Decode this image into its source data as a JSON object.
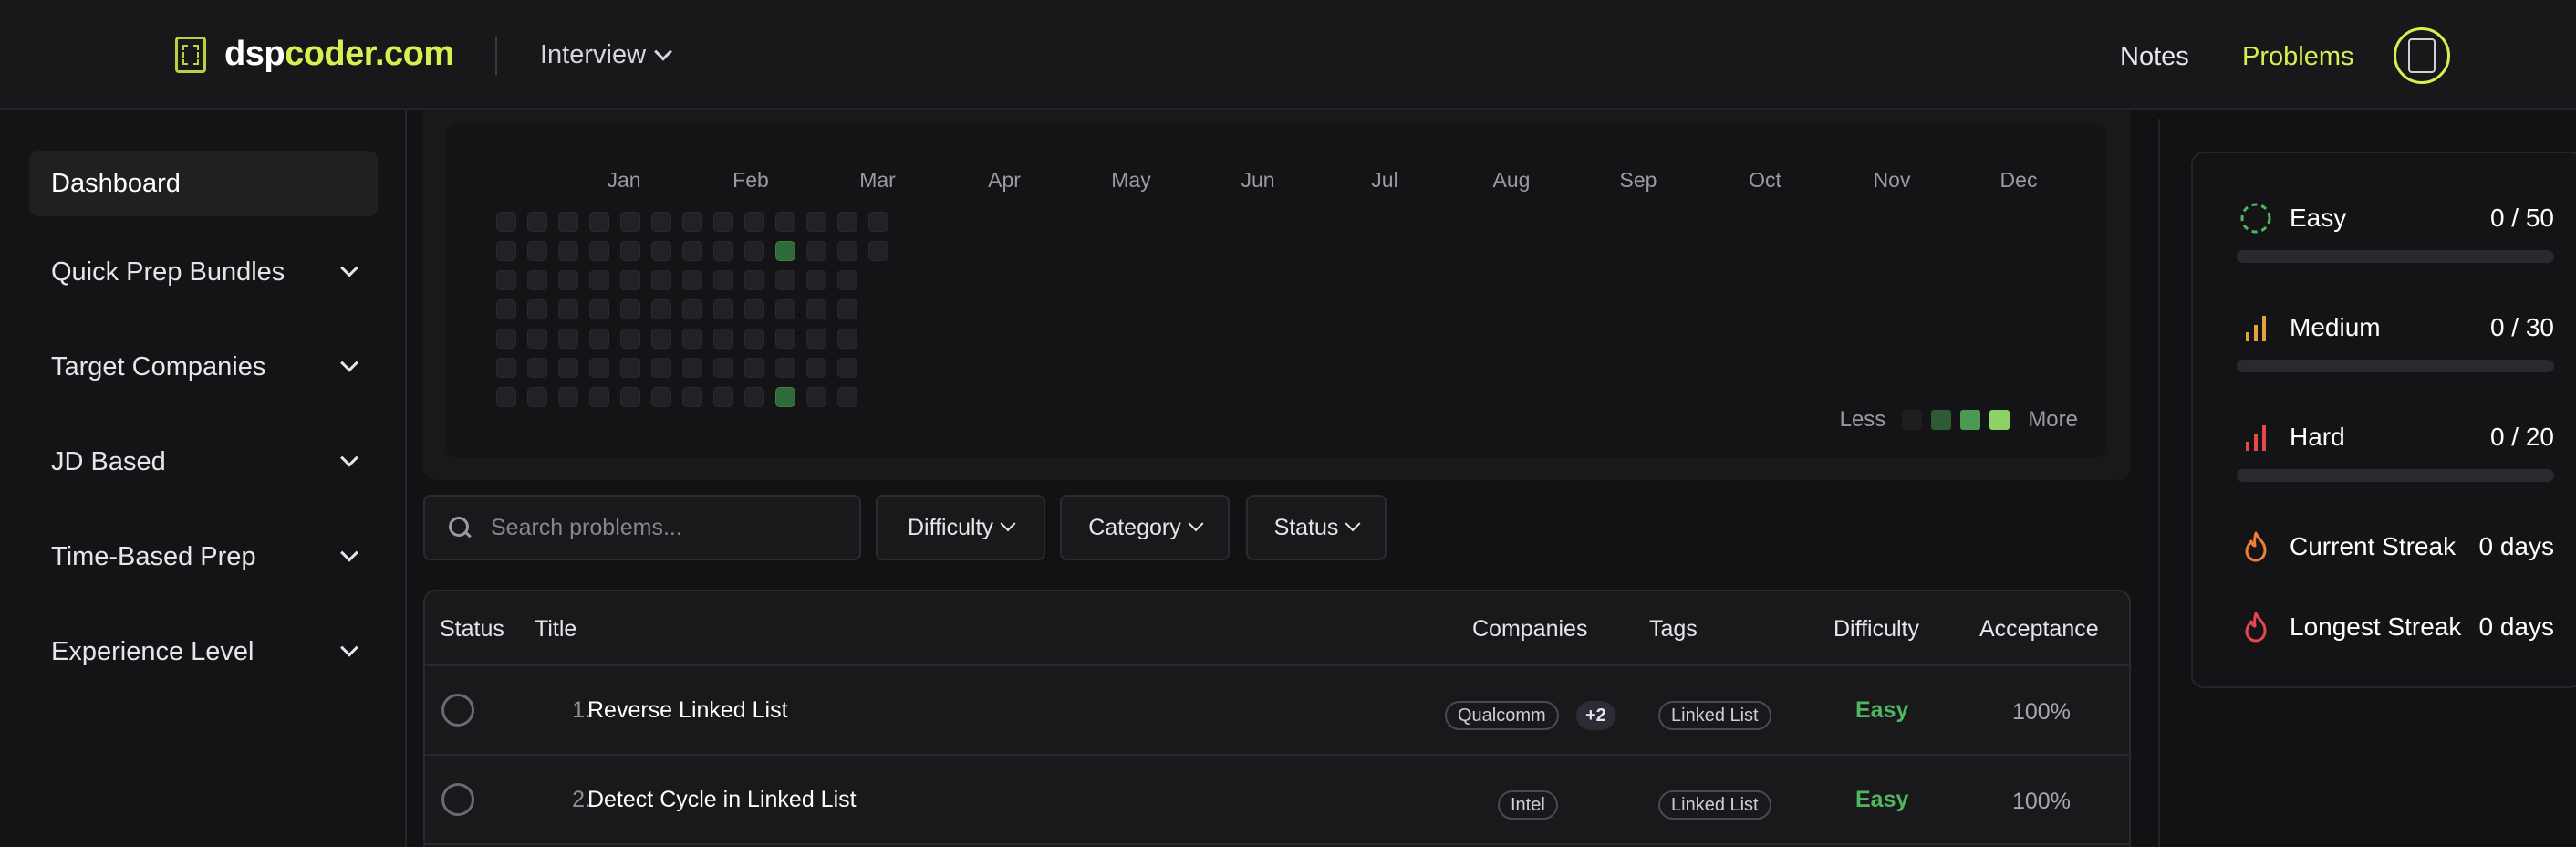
{
  "header": {
    "logo_part1": "dsp",
    "logo_part2": "coder.com",
    "mode": "Interview",
    "nav": {
      "notes": "Notes",
      "problems": "Problems"
    },
    "accent": "#d7ef52"
  },
  "sidebar": {
    "items": [
      {
        "label": "Dashboard",
        "active": true,
        "expandable": false
      },
      {
        "label": "Quick Prep Bundles",
        "active": false,
        "expandable": true
      },
      {
        "label": "Target Companies",
        "active": false,
        "expandable": true
      },
      {
        "label": "JD Based",
        "active": false,
        "expandable": true
      },
      {
        "label": "Time-Based Prep",
        "active": false,
        "expandable": true
      },
      {
        "label": "Experience Level",
        "active": false,
        "expandable": true
      }
    ]
  },
  "heatmap": {
    "months": [
      "Jan",
      "Feb",
      "Mar",
      "Apr",
      "May",
      "Jun",
      "Jul",
      "Aug",
      "Sep",
      "Oct",
      "Nov",
      "Dec"
    ],
    "active_days": [
      {
        "week": 9,
        "day": 1,
        "level": 2
      },
      {
        "week": 9,
        "day": 6,
        "level": 2
      }
    ],
    "legend": {
      "less": "Less",
      "more": "More",
      "colors": [
        "#1e1e21",
        "#2f5a36",
        "#4a9a52",
        "#8fd169"
      ]
    }
  },
  "filters": {
    "search_placeholder": "Search problems...",
    "difficulty": "Difficulty",
    "category": "Category",
    "status": "Status"
  },
  "table": {
    "headers": {
      "status": "Status",
      "title": "Title",
      "companies": "Companies",
      "tags": "Tags",
      "difficulty": "Difficulty",
      "acceptance": "Acceptance"
    },
    "rows": [
      {
        "num": "1.",
        "title": "Reverse Linked List",
        "company": "Qualcomm",
        "more": "+2",
        "tag": "Linked List",
        "difficulty": "Easy",
        "acceptance": "100%"
      },
      {
        "num": "2.",
        "title": "Detect Cycle in Linked List",
        "company": "Intel",
        "more": "",
        "tag": "Linked List",
        "difficulty": "Easy",
        "acceptance": "100%"
      }
    ]
  },
  "stats": {
    "easy": {
      "label": "Easy",
      "value": "0 / 50",
      "progress": 0,
      "color": "#4fb85f"
    },
    "medium": {
      "label": "Medium",
      "value": "0 / 30",
      "progress": 0,
      "color": "#e6a23c"
    },
    "hard": {
      "label": "Hard",
      "value": "0 / 20",
      "progress": 0,
      "color": "#e5484d"
    },
    "current_streak": {
      "label": "Current Streak",
      "value": "0 days"
    },
    "longest_streak": {
      "label": "Longest Streak",
      "value": "0 days"
    }
  }
}
